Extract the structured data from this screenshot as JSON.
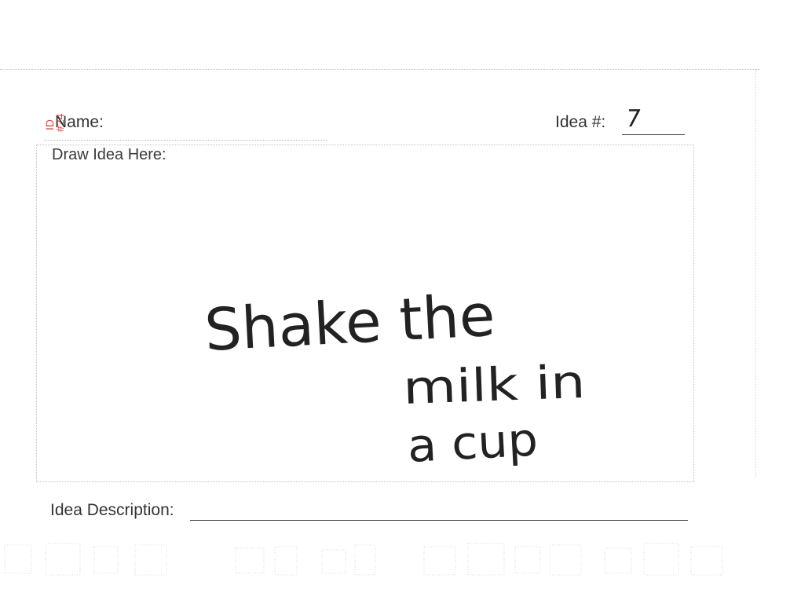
{
  "form": {
    "name_label": "Name:",
    "idea_number_label": "Idea #:",
    "idea_number_value": "7",
    "draw_label": "Draw Idea Here:",
    "description_label": "Idea Description:",
    "description_value": ""
  },
  "stamp": {
    "id_label": "ID",
    "id_value": "#24",
    "color": "#e8413a"
  },
  "handwritten_idea": {
    "line1": "Shake the",
    "line2": "milk in",
    "line3": "a cup"
  }
}
